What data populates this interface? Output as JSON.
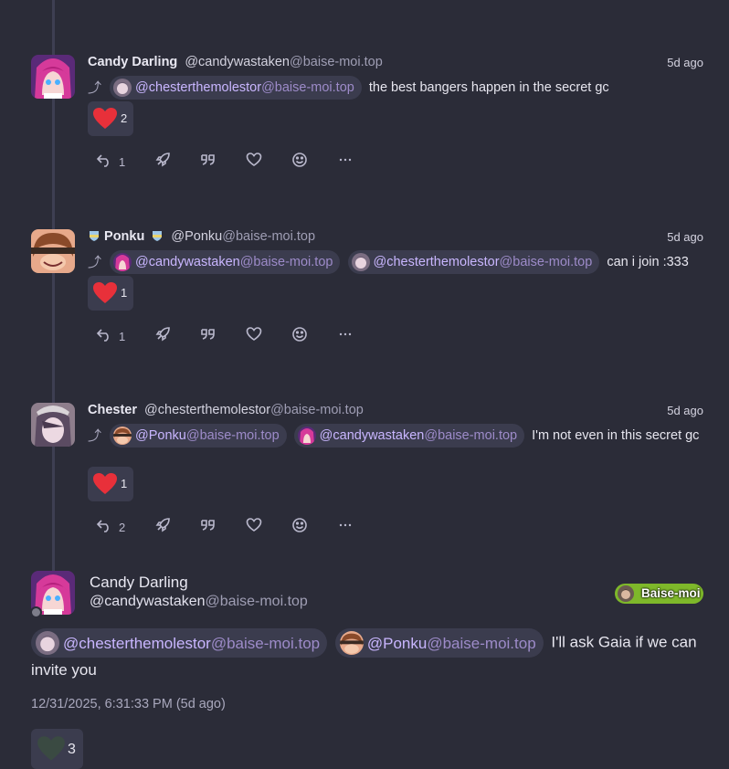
{
  "notes": [
    {
      "name": "Candy Darling",
      "handle_user": "@candywastaken",
      "handle_host": "@baise-moi.top",
      "time": "5d ago",
      "mentions": [
        {
          "user": "@chesterthemolestor",
          "host": "@baise-moi.top"
        }
      ],
      "text": "the best bangers happen in the secret gc",
      "reaction_count": "2",
      "reply_count": "1"
    },
    {
      "name": "Ponku",
      "name_emoji": "shield-badge",
      "handle_user": "@Ponku",
      "handle_host": "@baise-moi.top",
      "time": "5d ago",
      "mentions": [
        {
          "user": "@candywastaken",
          "host": "@baise-moi.top"
        },
        {
          "user": "@chesterthemolestor",
          "host": "@baise-moi.top"
        }
      ],
      "text": "can i join :333",
      "reaction_count": "1",
      "reply_count": "1"
    },
    {
      "name": "Chester",
      "handle_user": "@chesterthemolestor",
      "handle_host": "@baise-moi.top",
      "time": "5d ago",
      "mentions": [
        {
          "user": "@Ponku",
          "host": "@baise-moi.top"
        },
        {
          "user": "@candywastaken",
          "host": "@baise-moi.top"
        }
      ],
      "text": "I'm not even in this secret gc",
      "reaction_count": "1",
      "reply_count": "2"
    }
  ],
  "focused": {
    "name": "Candy Darling",
    "handle_user": "@candywastaken",
    "handle_host": "@baise-moi.top",
    "instance": "Baise-moi",
    "mentions": [
      {
        "user": "@chesterthemolestor",
        "host": "@baise-moi.top"
      },
      {
        "user": "@Ponku",
        "host": "@baise-moi.top"
      }
    ],
    "text": "I'll ask Gaia if we can invite you",
    "timestamp": "12/31/2025, 6:31:33 PM (5d ago)",
    "reaction_count": "3"
  },
  "icons": {
    "reply": "reply-icon",
    "renote": "rocket-icon",
    "quote": "quote-icon",
    "like": "heart-outline-icon",
    "react": "smiley-icon",
    "more": "ellipsis-icon",
    "thread": "reply-arrow-icon"
  },
  "colors": {
    "background": "#2b2c38",
    "mention_bg": "#3b3c4e",
    "mention_text": "#c9b6ff",
    "heart": "#e8303a",
    "instance_badge": "#7eb82a"
  }
}
